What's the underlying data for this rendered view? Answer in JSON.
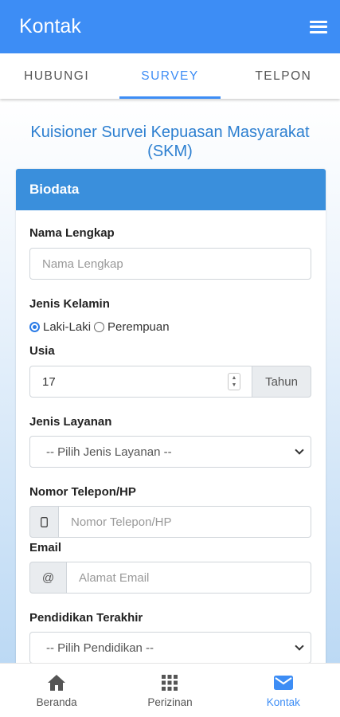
{
  "appbar": {
    "title": "Kontak",
    "menu_icon": "hamburger-menu-icon"
  },
  "tabs": [
    {
      "label": "HUBUNGI",
      "active": false
    },
    {
      "label": "SURVEY",
      "active": true
    },
    {
      "label": "TELPON",
      "active": false
    }
  ],
  "survey": {
    "title": "Kuisioner Survei Kepuasan Masyarakat (SKM)",
    "card_header": "Biodata",
    "nama": {
      "label": "Nama Lengkap",
      "placeholder": "Nama Lengkap"
    },
    "gender": {
      "label": "Jenis Kelamin",
      "options": [
        "Laki-Laki",
        "Perempuan"
      ],
      "selected": "Laki-Laki"
    },
    "usia": {
      "label": "Usia",
      "value": "17",
      "unit": "Tahun"
    },
    "layanan": {
      "label": "Jenis Layanan",
      "selected": "-- Pilih Jenis Layanan --"
    },
    "telepon": {
      "label": "Nomor Telepon/HP",
      "placeholder": "Nomor Telepon/HP",
      "icon": "phone-icon"
    },
    "email": {
      "label": "Email",
      "placeholder": "Alamat Email",
      "addon": "@"
    },
    "pendidikan": {
      "label": "Pendidikan Terakhir",
      "selected": "-- Pilih Pendidikan --"
    }
  },
  "bottom_nav": [
    {
      "label": "Beranda",
      "icon": "home-icon",
      "active": false
    },
    {
      "label": "Perizinan",
      "icon": "grid-icon",
      "active": false
    },
    {
      "label": "Kontak",
      "icon": "mail-icon",
      "active": true
    }
  ],
  "colors": {
    "primary": "#3d8df5",
    "card_header": "#3a8fdc",
    "title": "#2c7fd0"
  }
}
